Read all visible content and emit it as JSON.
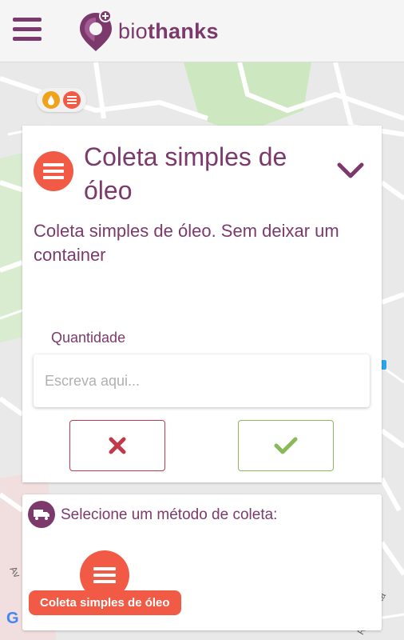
{
  "header": {
    "menu_icon": "hamburger-menu-icon",
    "logo_icon": "pin-drop-logo-icon",
    "logo_prefix": "bio",
    "logo_suffix": "thanks"
  },
  "map": {
    "badges": [
      {
        "icon": "oil-drop-icon",
        "color": "#f0a21a"
      },
      {
        "icon": "list-icon",
        "color": "#f15a45"
      }
    ],
    "street_label_left": "Av",
    "street_label_right": "R. Augusta",
    "attribution": "G"
  },
  "service_card": {
    "icon": "list-icon",
    "title": "Coleta simples de óleo",
    "collapse_icon": "chevron-down-icon",
    "description": "Coleta simples de óleo. Sem deixar um container",
    "quantity_label": "Quantidade",
    "quantity_placeholder": "Escreva aqui...",
    "quantity_value": "",
    "cancel_icon": "close-icon",
    "confirm_icon": "check-icon"
  },
  "method_card": {
    "icon": "truck-icon",
    "title": "Selecione um método de coleta:",
    "options": [
      {
        "label": "Coleta simples de óleo",
        "icon": "list-icon"
      }
    ]
  },
  "colors": {
    "brand": "#7b3a6b",
    "accent": "#f15a45",
    "cancel": "#c23a4a",
    "confirm": "#8ab95a",
    "oil": "#f0a21a"
  }
}
